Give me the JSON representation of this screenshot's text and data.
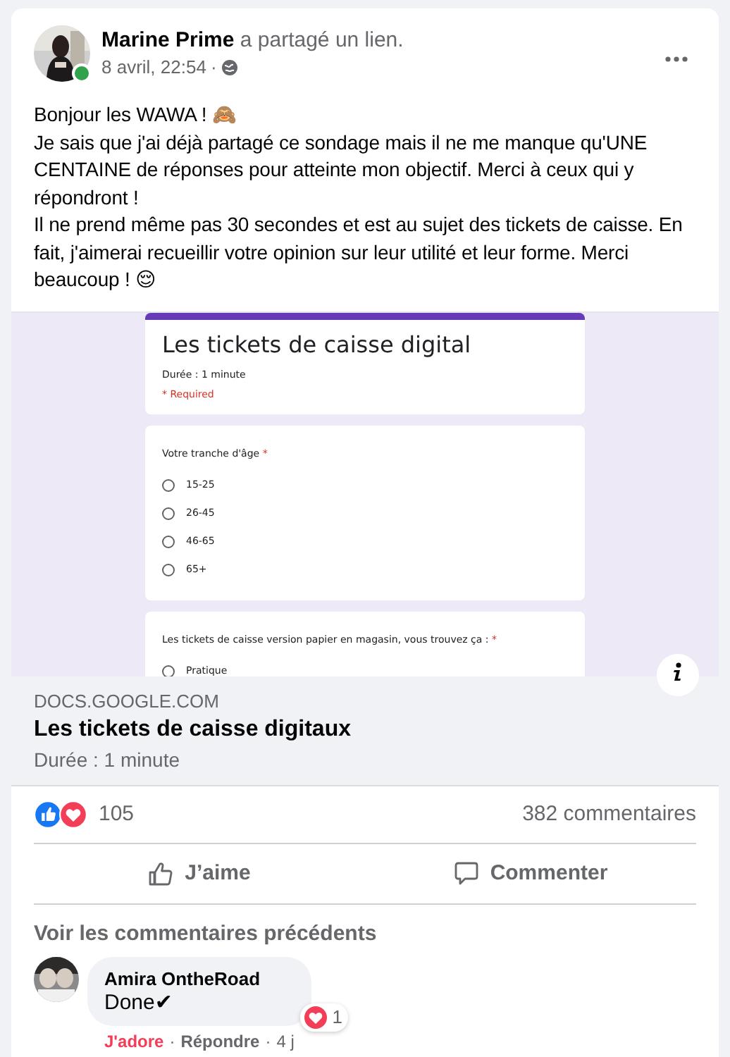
{
  "post": {
    "author": "Marine Prime",
    "action": "a partagé un lien.",
    "date": "8 avril, 22:54",
    "separator": "·",
    "online": true,
    "paragraphs": [
      "Bonjour les WAWA ! 🙈",
      "Je sais que j'ai déjà partagé ce sondage mais il ne me manque qu'UNE CENTAINE de réponses pour atteinte mon objectif. Merci à ceux qui y répondront !",
      "Il ne prend même pas 30 secondes et est au sujet des tickets de caisse. En fait, j'aimerai recueillir votre opinion sur leur utilité et leur forme. Merci beaucoup ! 😌"
    ]
  },
  "form_preview": {
    "title": "Les tickets de caisse digital",
    "subtitle": "Durée : 1 minute",
    "required_note": "* Required",
    "questions": [
      {
        "label": "Votre tranche d'âge",
        "required_mark": "*",
        "options": [
          {
            "label": "15-25",
            "selected": false
          },
          {
            "label": "26-45",
            "selected": false
          },
          {
            "label": "46-65",
            "selected": false
          },
          {
            "label": "65+",
            "selected": false
          }
        ]
      },
      {
        "label": "Les tickets de caisse version papier en magasin, vous trouvez ça :",
        "required_mark": "*",
        "options": [
          {
            "label": "Pratique",
            "selected": false
          }
        ]
      }
    ]
  },
  "link": {
    "domain": "DOCS.GOOGLE.COM",
    "title": "Les tickets de caisse digitaux",
    "description": "Durée : 1 minute"
  },
  "stats": {
    "reactions": [
      {
        "kind": "like"
      },
      {
        "kind": "love"
      }
    ],
    "reaction_count": "105",
    "comments": "382 commentaires"
  },
  "actions": [
    {
      "kind": "like",
      "label": "J’aime"
    },
    {
      "kind": "comment",
      "label": "Commenter"
    }
  ],
  "previous_comments": "Voir les commentaires précédents",
  "comments": [
    {
      "author": "Amira OntheRoad",
      "text": "Done✔",
      "reaction": {
        "kind": "love",
        "count": "1"
      },
      "links": [
        {
          "label": "J'adore",
          "selected": true
        },
        {
          "label": "Répondre",
          "selected": false
        }
      ],
      "separator": "·",
      "age": "4 j"
    }
  ]
}
